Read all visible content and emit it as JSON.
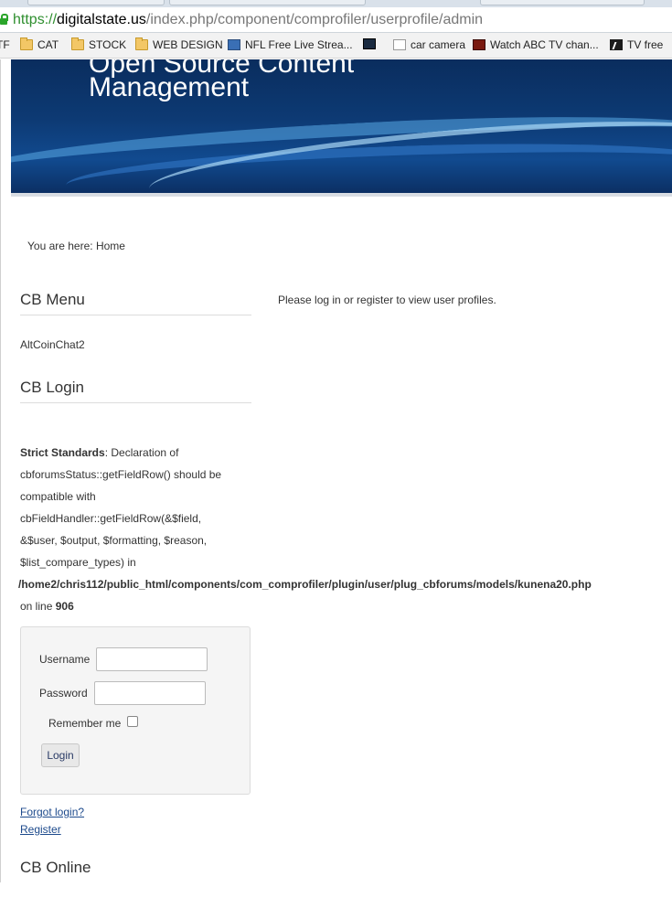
{
  "browser": {
    "url_scheme": "https://",
    "url_host": "digitalstate.us",
    "url_path": "/index.php/component/comprofiler/userprofile/admin",
    "bookmarks": [
      {
        "label": "TF",
        "icon": "folder-icon"
      },
      {
        "label": "CAT",
        "icon": "folder-icon"
      },
      {
        "label": "STOCK",
        "icon": "folder-icon"
      },
      {
        "label": "WEB DESIGN",
        "icon": "folder-icon"
      },
      {
        "label": "NFL Free Live Strea...",
        "icon": "monitor-icon"
      },
      {
        "label": "",
        "icon": "site-icon"
      },
      {
        "label": "car camera",
        "icon": "page-icon"
      },
      {
        "label": "Watch ABC TV chan...",
        "icon": "abc-live-icon"
      },
      {
        "label": "TV free",
        "icon": "tv-icon"
      }
    ]
  },
  "header": {
    "site_title_line1": "Open Source Content",
    "site_title_line2": "Management"
  },
  "breadcrumb": {
    "text": "You are here: Home"
  },
  "sidebar": {
    "cb_menu_title": "CB Menu",
    "cb_menu_items": [
      "AltCoinChat2"
    ],
    "cb_login_title": "CB Login",
    "warning": {
      "label": "Strict Standards",
      "line1_rest": ": Declaration of",
      "line2": "cbforumsStatus::getFieldRow() should be",
      "line3": "compatible with",
      "line4": "cbFieldHandler::getFieldRow(&$field,",
      "line5": "&$user, $output, $formatting, $reason,",
      "line6": "$list_compare_types) in",
      "path": "/home2/chris112/public_html/components/com_comprofiler/plugin/user/plug_cbforums/models/kunena20.php",
      "on_line_text": "on line",
      "line_number": "906"
    },
    "login_form": {
      "username_label": "Username",
      "password_label": "Password",
      "remember_label": "Remember me",
      "login_button": "Login",
      "username_value": "",
      "password_value": ""
    },
    "forgot_login": "Forgot login?",
    "register": "Register",
    "cb_online_title": "CB Online"
  },
  "main": {
    "message": "Please log in or register to view user profiles."
  }
}
